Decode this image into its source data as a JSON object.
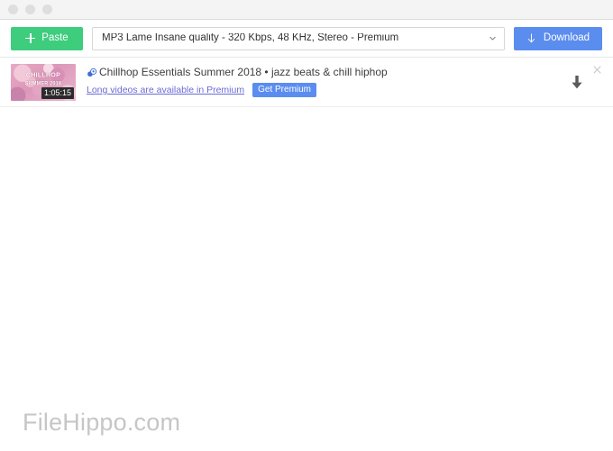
{
  "window": {
    "traffic_lights": [
      "close",
      "minimize",
      "maximize"
    ]
  },
  "toolbar": {
    "paste_label": "Paste",
    "paste_icon": "plus-icon",
    "format_value": "MP3 Lame Insane quality - 320 Kbps, 48 KHz, Stereo - Premium",
    "format_dropdown_icon": "chevron-down-icon",
    "download_label": "Download",
    "download_icon": "download-arrow-icon",
    "colors": {
      "paste_bg": "#3ecc7d",
      "download_bg": "#5b8def",
      "input_border": "#d7d7d7"
    }
  },
  "downloads": {
    "items": [
      {
        "title": "Chillhop Essentials Summer 2018 • jazz beats & chill hiphop",
        "duration": "1:05:15",
        "favicon": "site-favicon-icon",
        "thumbnail_art_top": "CHILLHOP",
        "thumbnail_art_bottom": "SUMMER 2018",
        "premium_note": "Long videos are available in Premium",
        "premium_button": "Get Premium",
        "row_download_icon": "download-arrow-icon",
        "close_icon": "close-icon",
        "colors": {
          "premium_badge_bg": "#5b8def",
          "premium_link": "#6a6ad6"
        }
      }
    ]
  },
  "watermark": {
    "text": "FileHippo.com",
    "color": "#c6c6c6"
  }
}
